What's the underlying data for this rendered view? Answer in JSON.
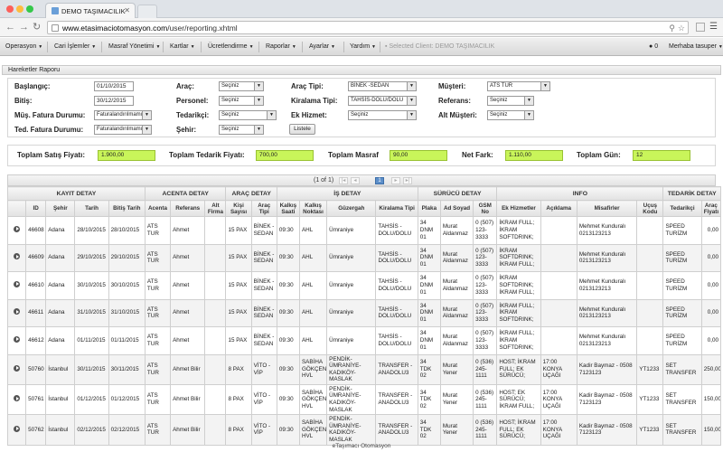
{
  "browser": {
    "tab_title": "DEMO TAŞIMACILIK",
    "url_host": "www.etasimaciotomasyon.com",
    "url_path": "/user/reporting.xhtml"
  },
  "menu": {
    "items": [
      {
        "label": "Operasyon"
      },
      {
        "label": "Cari İşlemler"
      },
      {
        "label": "Masraf Yönetimi"
      },
      {
        "label": "Kartlar"
      },
      {
        "label": "Ücretlendirme"
      },
      {
        "label": "Raporlar"
      },
      {
        "label": "Ayarlar"
      },
      {
        "label": "Yardım"
      }
    ],
    "selected_client": "Selected Client: DEMO TAŞIMACILIK",
    "notif_count": "0",
    "user": "Merhaba tasuper"
  },
  "panel": {
    "title": "Hareketler Raporu"
  },
  "filters": {
    "baslangic_label": "Başlangıç:",
    "baslangic_value": "01/10/2015",
    "bitis_label": "Bitiş:",
    "bitis_value": "30/12/2015",
    "mus_fatura_label": "Müş. Fatura Durumu:",
    "mus_fatura_value": "Faturalandırılmamış",
    "ted_fatura_label": "Ted. Fatura Durumu:",
    "ted_fatura_value": "Faturalandırılmamış",
    "arac_label": "Araç:",
    "arac_value": "Seçiniz",
    "personel_label": "Personel:",
    "personel_value": "Seçiniz",
    "tedarikci_label": "Tedarikçi:",
    "tedarikci_value": "Seçiniz",
    "sehir_label": "Şehir:",
    "sehir_value": "Seçiniz",
    "arac_tipi_label": "Araç Tipi:",
    "arac_tipi_value": "BİNEK -SEDAN",
    "kiralama_tipi_label": "Kiralama Tipi:",
    "kiralama_tipi_value": "TAHSİS-DOLU/DOLU",
    "ek_hizmet_label": "Ek Hizmet:",
    "ek_hizmet_value": "Seçiniz",
    "musteri_label": "Müşteri:",
    "musteri_value": "ATS TUR",
    "referans_label": "Referans:",
    "referans_value": "Seçiniz",
    "alt_musteri_label": "Alt Müşteri:",
    "alt_musteri_value": "Seçiniz",
    "listele_label": "Listele"
  },
  "totals": {
    "satis_label": "Toplam Satış Fiyatı:",
    "satis_value": "1.900,00",
    "tedarik_label": "Toplam Tedarik Fiyatı:",
    "tedarik_value": "700,00",
    "masraf_label": "Toplam Masraf",
    "masraf_value": "90,00",
    "netfark_label": "Net Fark:",
    "netfark_value": "1.110,00",
    "gun_label": "Toplam Gün:",
    "gun_value": "12"
  },
  "pager": {
    "info": "(1 of 1)",
    "current": "1"
  },
  "table": {
    "groups": [
      "KAYIT DETAY",
      "ACENTA DETAY",
      "ARAÇ DETAY",
      "İŞ DETAY",
      "SÜRÜCÜ DETAY",
      "INFO",
      "TEDARİK DETAY"
    ],
    "headers": [
      "",
      "ID",
      "Şehir",
      "Tarih",
      "Bitiş Tarih",
      "Acenta",
      "Referans",
      "Alt Firma",
      "Kişi Sayısı",
      "Araç Tipi",
      "Kalkış Saati",
      "Kalkış Noktası",
      "Güzergah",
      "Kiralama Tipi",
      "Plaka",
      "Ad Soyad",
      "GSM No",
      "Ek Hizmetler",
      "Açıklama",
      "Misafirler",
      "Uçuş Kodu",
      "Tedarikçi",
      "Araç Fiyatı"
    ],
    "rows": [
      [
        "46608",
        "Adana",
        "28/10/2015",
        "28/10/2015",
        "ATS TUR",
        "Ahmet",
        "",
        "15 PAX",
        "BİNEK - SEDAN",
        "09:30",
        "AHL",
        "Ümraniye",
        "TAHSİS - DOLU/DOLU",
        "34 DNM 01",
        "Murat Aldanmaz",
        "0 (507) 123-3333",
        "İKRAM FULL; İKRAM SOFTDRINK;",
        "",
        "Mehmet Kunduralı 0213123213",
        "",
        "SPEED TURİZM",
        "0,00"
      ],
      [
        "46609",
        "Adana",
        "29/10/2015",
        "29/10/2015",
        "ATS TUR",
        "Ahmet",
        "",
        "15 PAX",
        "BİNEK - SEDAN",
        "09:30",
        "AHL",
        "Ümraniye",
        "TAHSİS - DOLU/DOLU",
        "34 DNM 01",
        "Murat Aldanmaz",
        "0 (507) 123-3333",
        "İKRAM SOFTDRINK; İKRAM FULL;",
        "",
        "Mehmet Kunduralı 0213123213",
        "",
        "SPEED TURİZM",
        "0,00"
      ],
      [
        "46610",
        "Adana",
        "30/10/2015",
        "30/10/2015",
        "ATS TUR",
        "Ahmet",
        "",
        "15 PAX",
        "BİNEK - SEDAN",
        "09:30",
        "AHL",
        "Ümraniye",
        "TAHSİS - DOLU/DOLU",
        "34 DNM 01",
        "Murat Aldanmaz",
        "0 (507) 123-3333",
        "İKRAM SOFTDRINK; İKRAM FULL;",
        "",
        "Mehmet Kunduralı 0213123213",
        "",
        "SPEED TURİZM",
        "0,00"
      ],
      [
        "46611",
        "Adana",
        "31/10/2015",
        "31/10/2015",
        "ATS TUR",
        "Ahmet",
        "",
        "15 PAX",
        "BİNEK - SEDAN",
        "09:30",
        "AHL",
        "Ümraniye",
        "TAHSİS - DOLU/DOLU",
        "34 DNM 01",
        "Murat Aldanmaz",
        "0 (507) 123-3333",
        "İKRAM FULL; İKRAM SOFTDRINK;",
        "",
        "Mehmet Kunduralı 0213123213",
        "",
        "SPEED TURİZM",
        "0,00"
      ],
      [
        "46612",
        "Adana",
        "01/11/2015",
        "01/11/2015",
        "ATS TUR",
        "Ahmet",
        "",
        "15 PAX",
        "BİNEK - SEDAN",
        "09:30",
        "AHL",
        "Ümraniye",
        "TAHSİS - DOLU/DOLU",
        "34 DNM 01",
        "Murat Aldanmaz",
        "0 (507) 123-3333",
        "İKRAM FULL; İKRAM SOFTDRINK;",
        "",
        "Mehmet Kunduralı 0213123213",
        "",
        "SPEED TURİZM",
        "0,00"
      ],
      [
        "50760",
        "İstanbul",
        "30/11/2015",
        "30/11/2015",
        "ATS TUR",
        "Ahmet Bilir",
        "",
        "8 PAX",
        "VİTO - VİP",
        "09:30",
        "SABİHA GÖKÇEN HVL",
        "PENDİK-ÜMRANİYE-KADIKÖY-MASLAK",
        "TRANSFER - ANADOLU3",
        "34 TDK 02",
        "Murat Yener",
        "0 (536) 245-1111",
        "HOST; İKRAM FULL; EK SÜRÜCÜ;",
        "17:00 KONYA UÇAĞI",
        "Kadir Baymaz - 0508 7123123",
        "YT1233",
        "SET TRANSFER",
        "250,00"
      ],
      [
        "50761",
        "İstanbul",
        "01/12/2015",
        "01/12/2015",
        "ATS TUR",
        "Ahmet Bilir",
        "",
        "8 PAX",
        "VİTO - VİP",
        "09:30",
        "SABİHA GÖKÇEN HVL",
        "PENDİK-ÜMRANİYE-KADIKÖY-MASLAK",
        "TRANSFER - ANADOLU3",
        "34 TDK 02",
        "Murat Yener",
        "0 (536) 245-1111",
        "HOST; EK SÜRÜCÜ; İKRAM FULL;",
        "17:00 KONYA UÇAĞI",
        "Kadir Baymaz - 0508 7123123",
        "YT1233",
        "SET TRANSFER",
        "150,00"
      ],
      [
        "50762",
        "İstanbul",
        "02/12/2015",
        "02/12/2015",
        "ATS TUR",
        "Ahmet Bilir",
        "",
        "8 PAX",
        "VİTO - VİP",
        "09:30",
        "SABİHA GÖKÇEN HVL",
        "PENDİK-ÜMRANİYE-KADIKÖY-MASLAK",
        "TRANSFER - ANADOLU3",
        "34 TDK 02",
        "Murat Yener",
        "0 (536) 245-1111",
        "HOST; İKRAM FULL; EK SÜRÜCÜ;",
        "17:00 KONYA UÇAĞI",
        "Kadir Baymaz - 0508 7123123",
        "YT1233",
        "SET TRANSFER",
        "150,00"
      ]
    ]
  },
  "footer": {
    "text": "eTaşımacı Otomasyon"
  }
}
